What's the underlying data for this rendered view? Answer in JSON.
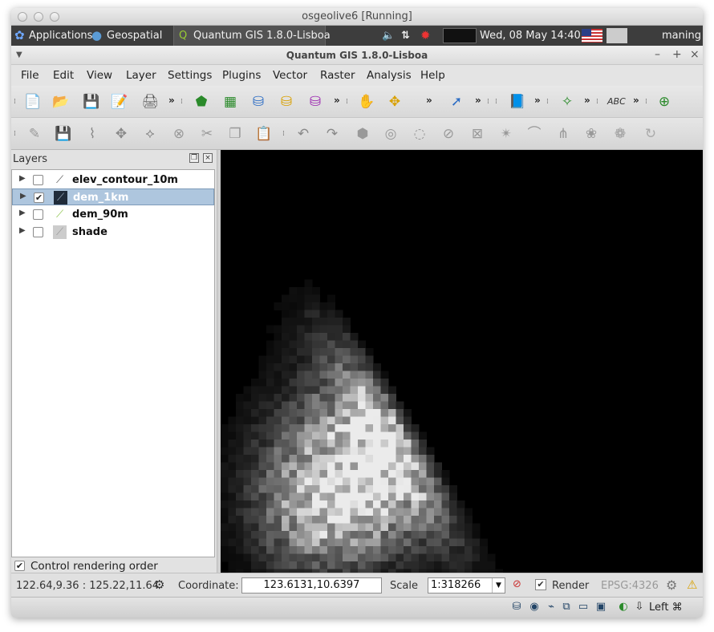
{
  "vbox_window": {
    "title": "osgeolive6 [Running]"
  },
  "top_panel": {
    "applications": "Applications",
    "geospatial": "Geospatial",
    "task": "Quantum GIS 1.8.0-Lisboa",
    "clock": "Wed, 08 May  14:40",
    "user": "maning"
  },
  "qgis_window": {
    "title": "Quantum GIS 1.8.0-Lisboa"
  },
  "menu": [
    "File",
    "Edit",
    "View",
    "Layer",
    "Settings",
    "Plugins",
    "Vector",
    "Raster",
    "Analysis",
    "Help"
  ],
  "layers_panel": {
    "title": "Layers",
    "layers": [
      {
        "name": "elev_contour_10m",
        "checked": false,
        "selected": false,
        "icon": "line-layer-icon"
      },
      {
        "name": "dem_1km",
        "checked": true,
        "selected": true,
        "icon": "raster-layer-icon"
      },
      {
        "name": "dem_90m",
        "checked": false,
        "selected": false,
        "icon": "raster-layer-icon"
      },
      {
        "name": "shade",
        "checked": false,
        "selected": false,
        "icon": "raster-layer-icon"
      }
    ],
    "control_rendering_order": "Control rendering order"
  },
  "statusbar": {
    "extent": "122.64,9.36 : 125.22,11.64",
    "coordinate_label": "Coordinate:",
    "coordinate_value": "123.6131,10.6397",
    "scale_label": "Scale",
    "scale_value": "1:318266",
    "render_label": "Render",
    "epsg": "EPSG:4326"
  },
  "vbox_status": {
    "host_key": "Left ⌘"
  },
  "colors": {
    "panel_bg": "#3d3d3d",
    "selection": "#aec6de",
    "map_bg": "#000000"
  }
}
